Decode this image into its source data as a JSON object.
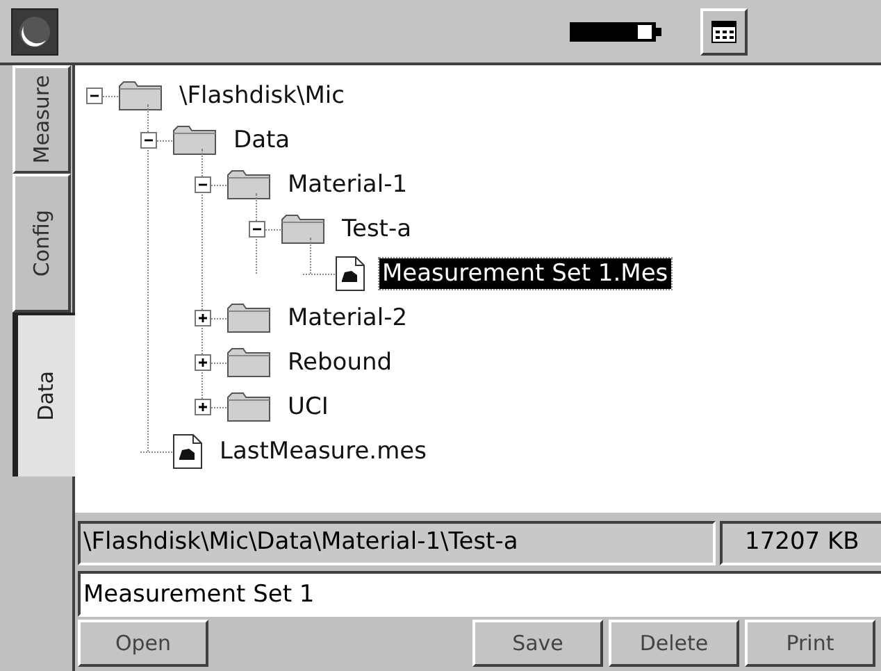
{
  "tabs": [
    {
      "label": "Measure",
      "selected": false
    },
    {
      "label": "Config",
      "selected": false
    },
    {
      "label": "Data",
      "selected": true
    }
  ],
  "tree": [
    {
      "kind": "folder",
      "label": "\\Flashdisk\\Mic",
      "expanded": true,
      "selected": false,
      "children": [
        {
          "kind": "folder",
          "label": "Data",
          "expanded": true,
          "selected": false,
          "children": [
            {
              "kind": "folder",
              "label": "Material-1",
              "expanded": true,
              "selected": false,
              "children": [
                {
                  "kind": "folder",
                  "label": "Test-a",
                  "expanded": true,
                  "selected": false,
                  "children": [
                    {
                      "kind": "file",
                      "label": "Measurement Set 1.Mes",
                      "selected": true
                    }
                  ]
                }
              ]
            },
            {
              "kind": "folder",
              "label": "Material-2",
              "expanded": false,
              "selected": false
            },
            {
              "kind": "folder",
              "label": "Rebound",
              "expanded": false,
              "selected": false
            },
            {
              "kind": "folder",
              "label": "UCI",
              "expanded": false,
              "selected": false
            }
          ]
        },
        {
          "kind": "file",
          "label": "LastMeasure.mes",
          "selected": false
        }
      ]
    }
  ],
  "path": "\\Flashdisk\\Mic\\Data\\Material-1\\Test-a",
  "free_space": "17207 KB",
  "name_field": {
    "value": "Measurement Set 1"
  },
  "buttons_left": [
    "Open"
  ],
  "buttons_right": [
    "Save",
    "Delete",
    "Print"
  ]
}
